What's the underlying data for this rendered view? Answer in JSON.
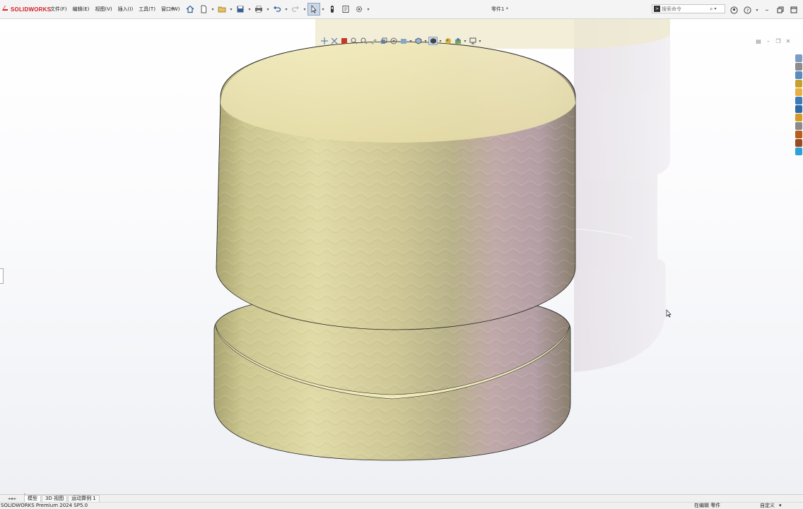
{
  "app": {
    "logo_prefix": "3DS",
    "logo_word": "SOLIDWORKS",
    "document_title": "零件1 *",
    "accent": "#d32027"
  },
  "menu": [
    {
      "label": "文件(F)"
    },
    {
      "label": "编辑(E)"
    },
    {
      "label": "视图(V)"
    },
    {
      "label": "插入(I)"
    },
    {
      "label": "工具(T)"
    },
    {
      "label": "窗口(W)"
    }
  ],
  "quick_access": [
    "home-icon",
    "new-document-icon",
    "open-folder-icon",
    "save-icon",
    "print-icon",
    "undo-icon",
    "redo-icon",
    "select-arrow-icon",
    "rebuild-icon",
    "file-properties-icon",
    "options-gear-icon"
  ],
  "search": {
    "placeholder": "搜索命令"
  },
  "title_controls": [
    "account-icon",
    "help-icon",
    "minimize-icon",
    "restore-icon",
    "maximize-icon",
    "close-icon"
  ],
  "heads_up_toolbar": [
    "zoom-to-fit-icon",
    "zoom-to-area-icon",
    "previous-view-icon",
    "section-view-icon",
    "dynamic-annotation-icon",
    "view-orientation-icon",
    "display-style-icon",
    "hide-show-items-icon",
    "edit-appearance-icon",
    "apply-scene-icon",
    "view-settings-icon",
    "display-monitor-icon"
  ],
  "task_pane_colors": [
    "#7d9cc4",
    "#8c8c8c",
    "#5a8ac0",
    "#c8a030",
    "#e8b040",
    "#3c7ab8",
    "#2d6aa8",
    "#d49b2a",
    "#8a8a8a",
    "#b55e1e",
    "#9a4a22",
    "#2ea0d8"
  ],
  "model": {
    "body_color": "#d8cf98",
    "cap_color": "#ece3b0",
    "shadow_color": "#ddd6e2"
  },
  "bottom_tabs": [
    {
      "label": "模型",
      "active": true
    },
    {
      "label": "3D 视图",
      "active": false
    },
    {
      "label": "运动算例 1",
      "active": false
    }
  ],
  "status": {
    "version": "SOLIDWORKS Premium 2024 SP5.0",
    "editing": "在编辑 零件",
    "units": "自定义"
  }
}
